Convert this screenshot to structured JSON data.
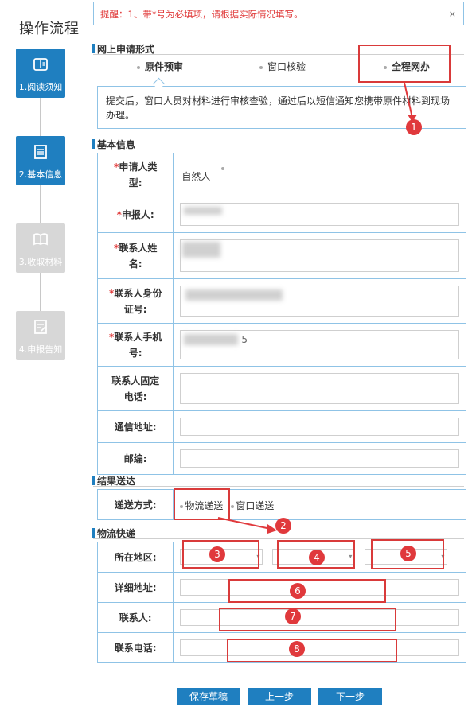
{
  "sidebar": {
    "title": "操作流程",
    "steps": [
      {
        "label": "1.阅读须知",
        "icon": "book-open-icon",
        "state": "active"
      },
      {
        "label": "2.基本信息",
        "icon": "document-list-icon",
        "state": "active"
      },
      {
        "label": "3.收取材料",
        "icon": "book-icon",
        "state": "inactive"
      },
      {
        "label": "4.申报告知",
        "icon": "edit-note-icon",
        "state": "inactive"
      }
    ]
  },
  "alert": {
    "text": "提醒：1、带*号为必填项，请根据实际情况填写。",
    "close": "×"
  },
  "online_apply": {
    "section_title": "网上申请形式",
    "tabs": [
      "原件预审",
      "窗口核验",
      "全程网办"
    ],
    "description": "提交后，窗口人员对材料进行审核查验，通过后以短信通知您携带原件材料到现场办理。"
  },
  "basic_info": {
    "section_title": "基本信息",
    "applicant_type_label": "申请人类型:",
    "applicant_type_value": "自然人",
    "declarant_label": "申报人:",
    "contact_name_label": "联系人姓名:",
    "contact_id_label": "联系人身份证号:",
    "contact_mobile_label": "联系人手机号:",
    "contact_mobile_visible_digit": "5",
    "contact_phone_label": "联系人固定电话:",
    "address_label": "通信地址:",
    "postcode_label": "邮编:"
  },
  "delivery": {
    "section_title": "结果送达",
    "method_label": "递送方式:",
    "options": [
      "物流递送",
      "窗口递送"
    ]
  },
  "logistics": {
    "section_title": "物流快递",
    "region_label": "所在地区:",
    "detail_address_label": "详细地址:",
    "contact_label": "联系人:",
    "contact_phone_label": "联系电话:"
  },
  "annotations": [
    "1",
    "2",
    "3",
    "4",
    "5",
    "6",
    "7",
    "8"
  ],
  "buttons": {
    "save_draft": "保存草稿",
    "prev": "上一步",
    "next": "下一步"
  },
  "colors": {
    "primary": "#1f7fc0",
    "border": "#8fc3e6",
    "required": "#e03a3a",
    "annotation": "#d93a3a"
  }
}
